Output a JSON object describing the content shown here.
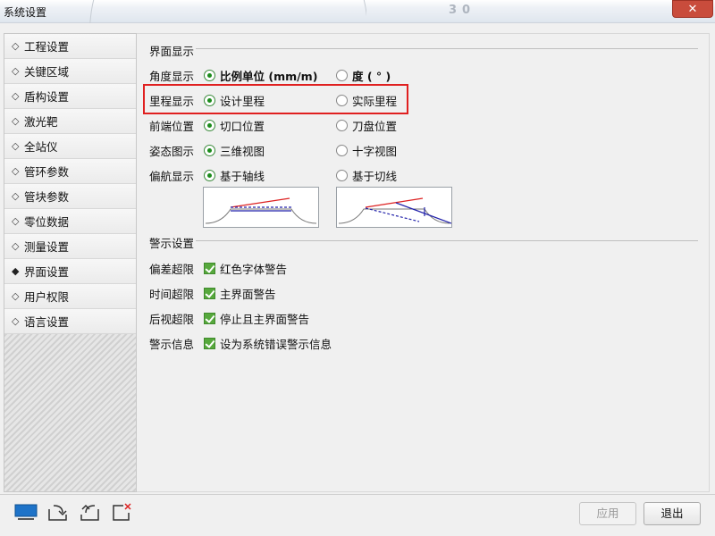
{
  "window": {
    "title": "系统设置",
    "background_number": "30"
  },
  "sidebar": {
    "items": [
      {
        "label": "工程设置",
        "active": false
      },
      {
        "label": "关键区域",
        "active": false
      },
      {
        "label": "盾构设置",
        "active": false
      },
      {
        "label": "激光靶",
        "active": false
      },
      {
        "label": "全站仪",
        "active": false
      },
      {
        "label": "管环参数",
        "active": false
      },
      {
        "label": "管块参数",
        "active": false
      },
      {
        "label": "零位数据",
        "active": false
      },
      {
        "label": "测量设置",
        "active": false
      },
      {
        "label": "界面设置",
        "active": true
      },
      {
        "label": "用户权限",
        "active": false
      },
      {
        "label": "语言设置",
        "active": false
      }
    ]
  },
  "display": {
    "section_title": "界面显示",
    "rows": [
      {
        "label": "角度显示",
        "option_a": "比例单位 (mm/m)",
        "option_b": "度 ( ° )",
        "selected": "a"
      },
      {
        "label": "里程显示",
        "option_a": "设计里程",
        "option_b": "实际里程",
        "selected": "a"
      },
      {
        "label": "前端位置",
        "option_a": "切口位置",
        "option_b": "刀盘位置",
        "selected": "a"
      },
      {
        "label": "姿态图示",
        "option_a": "三维视图",
        "option_b": "十字视图",
        "selected": "a"
      },
      {
        "label": "偏航显示",
        "option_a": "基于轴线",
        "option_b": "基于切线",
        "selected": "a"
      }
    ]
  },
  "warning": {
    "section_title": "警示设置",
    "rows": [
      {
        "label": "偏差超限",
        "option": "红色字体警告",
        "checked": true
      },
      {
        "label": "时间超限",
        "option": "主界面警告",
        "checked": true
      },
      {
        "label": "后视超限",
        "option": "停止且主界面警告",
        "checked": true
      },
      {
        "label": "警示信息",
        "option": "设为系统错误警示信息",
        "checked": true
      }
    ]
  },
  "footer": {
    "apply_label": "应用",
    "exit_label": "退出"
  },
  "colors": {
    "highlight": "#e02020",
    "radio_on": "#1c8c1c",
    "check": "#56a83c"
  }
}
